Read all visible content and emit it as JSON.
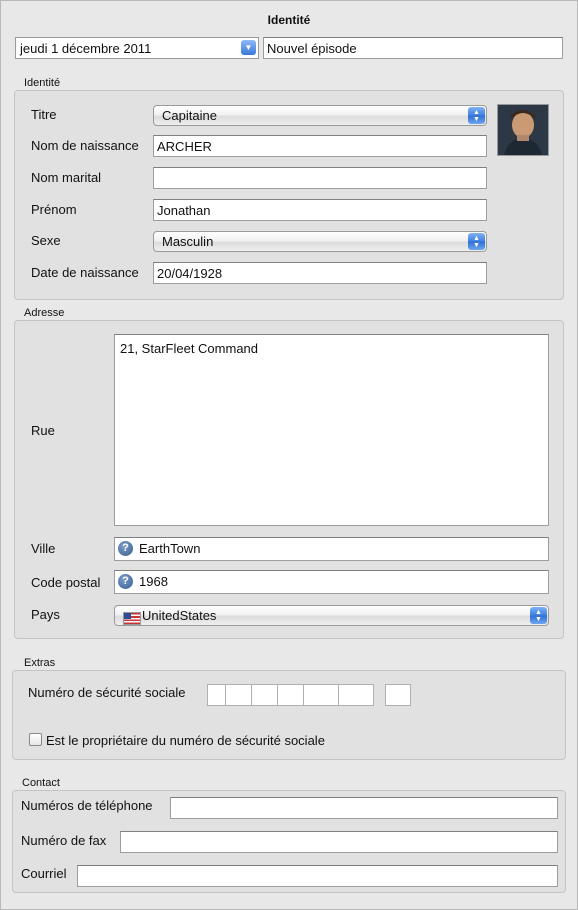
{
  "header": {
    "title": "Identité",
    "date_value": "jeudi 1 décembre 2011",
    "episode_value": "Nouvel épisode"
  },
  "identity": {
    "legend": "Identité",
    "titre_label": "Titre",
    "titre_value": "Capitaine",
    "nom_naissance_label": "Nom de naissance",
    "nom_naissance_value": "ARCHER",
    "nom_marital_label": "Nom marital",
    "nom_marital_value": "",
    "prenom_label": "Prénom",
    "prenom_value": "Jonathan",
    "sexe_label": "Sexe",
    "sexe_value": "Masculin",
    "date_naissance_label": "Date de naissance",
    "date_naissance_value": "20/04/1928"
  },
  "address": {
    "legend": "Adresse",
    "rue_label": "Rue",
    "rue_value": "21, StarFleet Command",
    "ville_label": "Ville",
    "ville_value": "EarthTown",
    "code_postal_label": "Code postal",
    "code_postal_value": "1968",
    "pays_label": "Pays",
    "pays_value": "UnitedStates"
  },
  "extras": {
    "legend": "Extras",
    "ssn_label": "Numéro de sécurité sociale",
    "owner_checkbox_label": "Est le propriétaire du numéro de sécurité sociale",
    "owner_checked": false
  },
  "contact": {
    "legend": "Contact",
    "telephone_label": "Numéros de téléphone",
    "telephone_value": "",
    "fax_label": "Numéro de fax",
    "fax_value": "",
    "courriel_label": "Courriel",
    "courriel_value": ""
  },
  "icons": {
    "help": "?",
    "popup_arrows": "▲▼",
    "date_arrow": "▼"
  }
}
